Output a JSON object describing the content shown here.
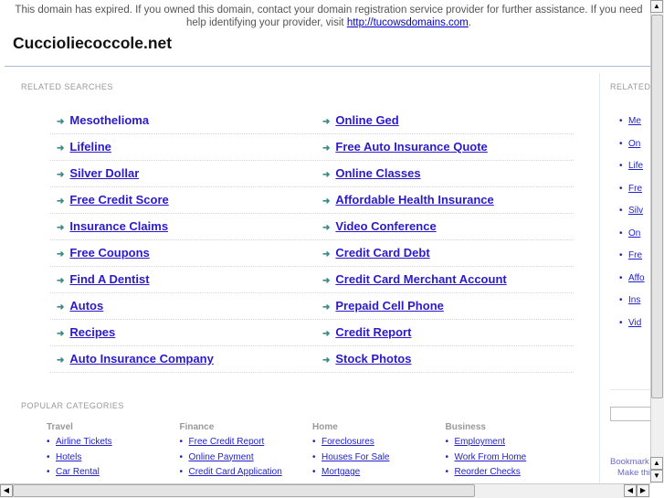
{
  "notice": {
    "text": "This domain has expired. If you owned this domain, contact your domain registration service provider for further assistance. If you need help identifying your provider, visit ",
    "link": "http://tucowsdomains.com",
    "end": "."
  },
  "title": "Cuccioliecoccole.net",
  "related_heading": "RELATED SEARCHES",
  "related": [
    [
      "Mesothelioma",
      "Online Ged"
    ],
    [
      "Lifeline",
      "Free Auto Insurance Quote"
    ],
    [
      "Silver Dollar",
      "Online Classes"
    ],
    [
      "Free Credit Score",
      "Affordable Health Insurance"
    ],
    [
      "Insurance Claims",
      "Video Conference"
    ],
    [
      "Free Coupons",
      "Credit Card Debt"
    ],
    [
      "Find A Dentist",
      "Credit Card Merchant Account"
    ],
    [
      "Autos",
      "Prepaid Cell Phone"
    ],
    [
      "Recipes",
      "Credit Report"
    ],
    [
      "Auto Insurance Company",
      "Stock Photos"
    ]
  ],
  "side_heading": "RELATED",
  "side_items": [
    "Me",
    "On",
    "Life",
    "Fre",
    "Silv",
    "On",
    "Fre",
    "Affo",
    "Ins",
    "Vid"
  ],
  "bookmark": "Bookmark",
  "make": "Make thi",
  "popular_heading": "POPULAR CATEGORIES",
  "categories": [
    {
      "name": "Travel",
      "links": [
        "Airline Tickets",
        "Hotels",
        "Car Rental"
      ]
    },
    {
      "name": "Finance",
      "links": [
        "Free Credit Report",
        "Online Payment",
        "Credit Card Application"
      ]
    },
    {
      "name": "Home",
      "links": [
        "Foreclosures",
        "Houses For Sale",
        "Mortgage"
      ]
    },
    {
      "name": "Business",
      "links": [
        "Employment",
        "Work From Home",
        "Reorder Checks"
      ]
    }
  ],
  "colors": {
    "link": "#2a1acc",
    "arrow": "#3a8a88",
    "rule": "#a8bcd8"
  }
}
